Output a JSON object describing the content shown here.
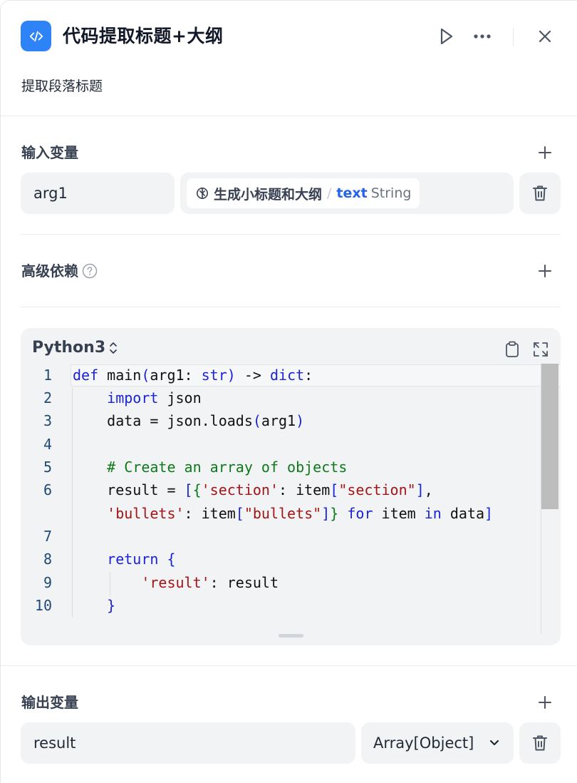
{
  "header": {
    "title": "代码提取标题+大纲",
    "description": "提取段落标题",
    "icons": [
      "code-icon",
      "play-icon",
      "more-icon",
      "close-icon"
    ]
  },
  "input_section": {
    "label": "输入变量",
    "variable_name": "arg1",
    "ref_node": "生成小标题和大纲",
    "ref_separator": "/",
    "ref_var": "text",
    "ref_type": "String"
  },
  "advanced_section": {
    "label": "高级依赖"
  },
  "code_editor": {
    "language": "Python3",
    "line_numbers": [
      "1",
      "2",
      "3",
      "4",
      "5",
      "6",
      "7",
      "8",
      "9",
      "10"
    ]
  },
  "output_section": {
    "label": "输出变量",
    "variable_name": "result",
    "type": "Array[Object]"
  },
  "colors": {
    "accent": "#2e84f7",
    "keyword": "#1a23d6",
    "comment": "#0d7a1a",
    "string": "#a31515"
  }
}
